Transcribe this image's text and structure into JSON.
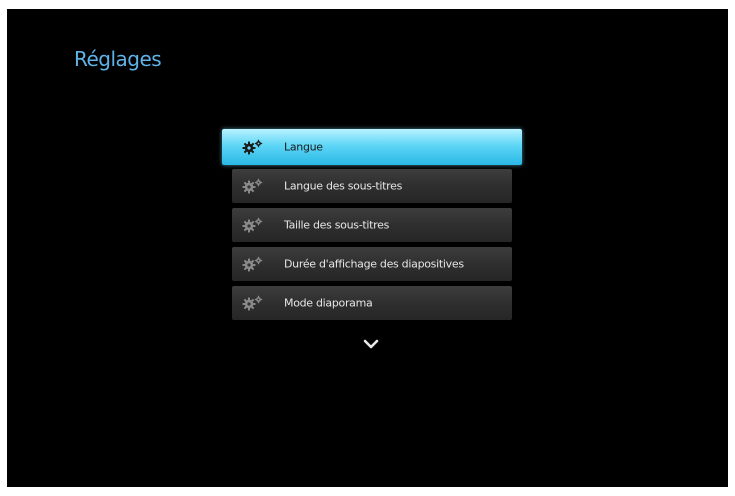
{
  "page": {
    "title": "Réglages",
    "accent_color": "#5fb3e8",
    "selection_color": "#2ab8e6"
  },
  "menu": {
    "items": [
      {
        "label": "Langue",
        "icon": "gears-icon",
        "selected": true
      },
      {
        "label": "Langue des sous-titres",
        "icon": "gears-icon",
        "selected": false
      },
      {
        "label": "Taille des sous-titres",
        "icon": "gears-icon",
        "selected": false
      },
      {
        "label": "Durée d'affichage des diapositives",
        "icon": "gears-icon",
        "selected": false
      },
      {
        "label": "Mode diaporama",
        "icon": "gears-icon",
        "selected": false
      }
    ],
    "more_indicator_icon": "chevron-down-icon"
  }
}
